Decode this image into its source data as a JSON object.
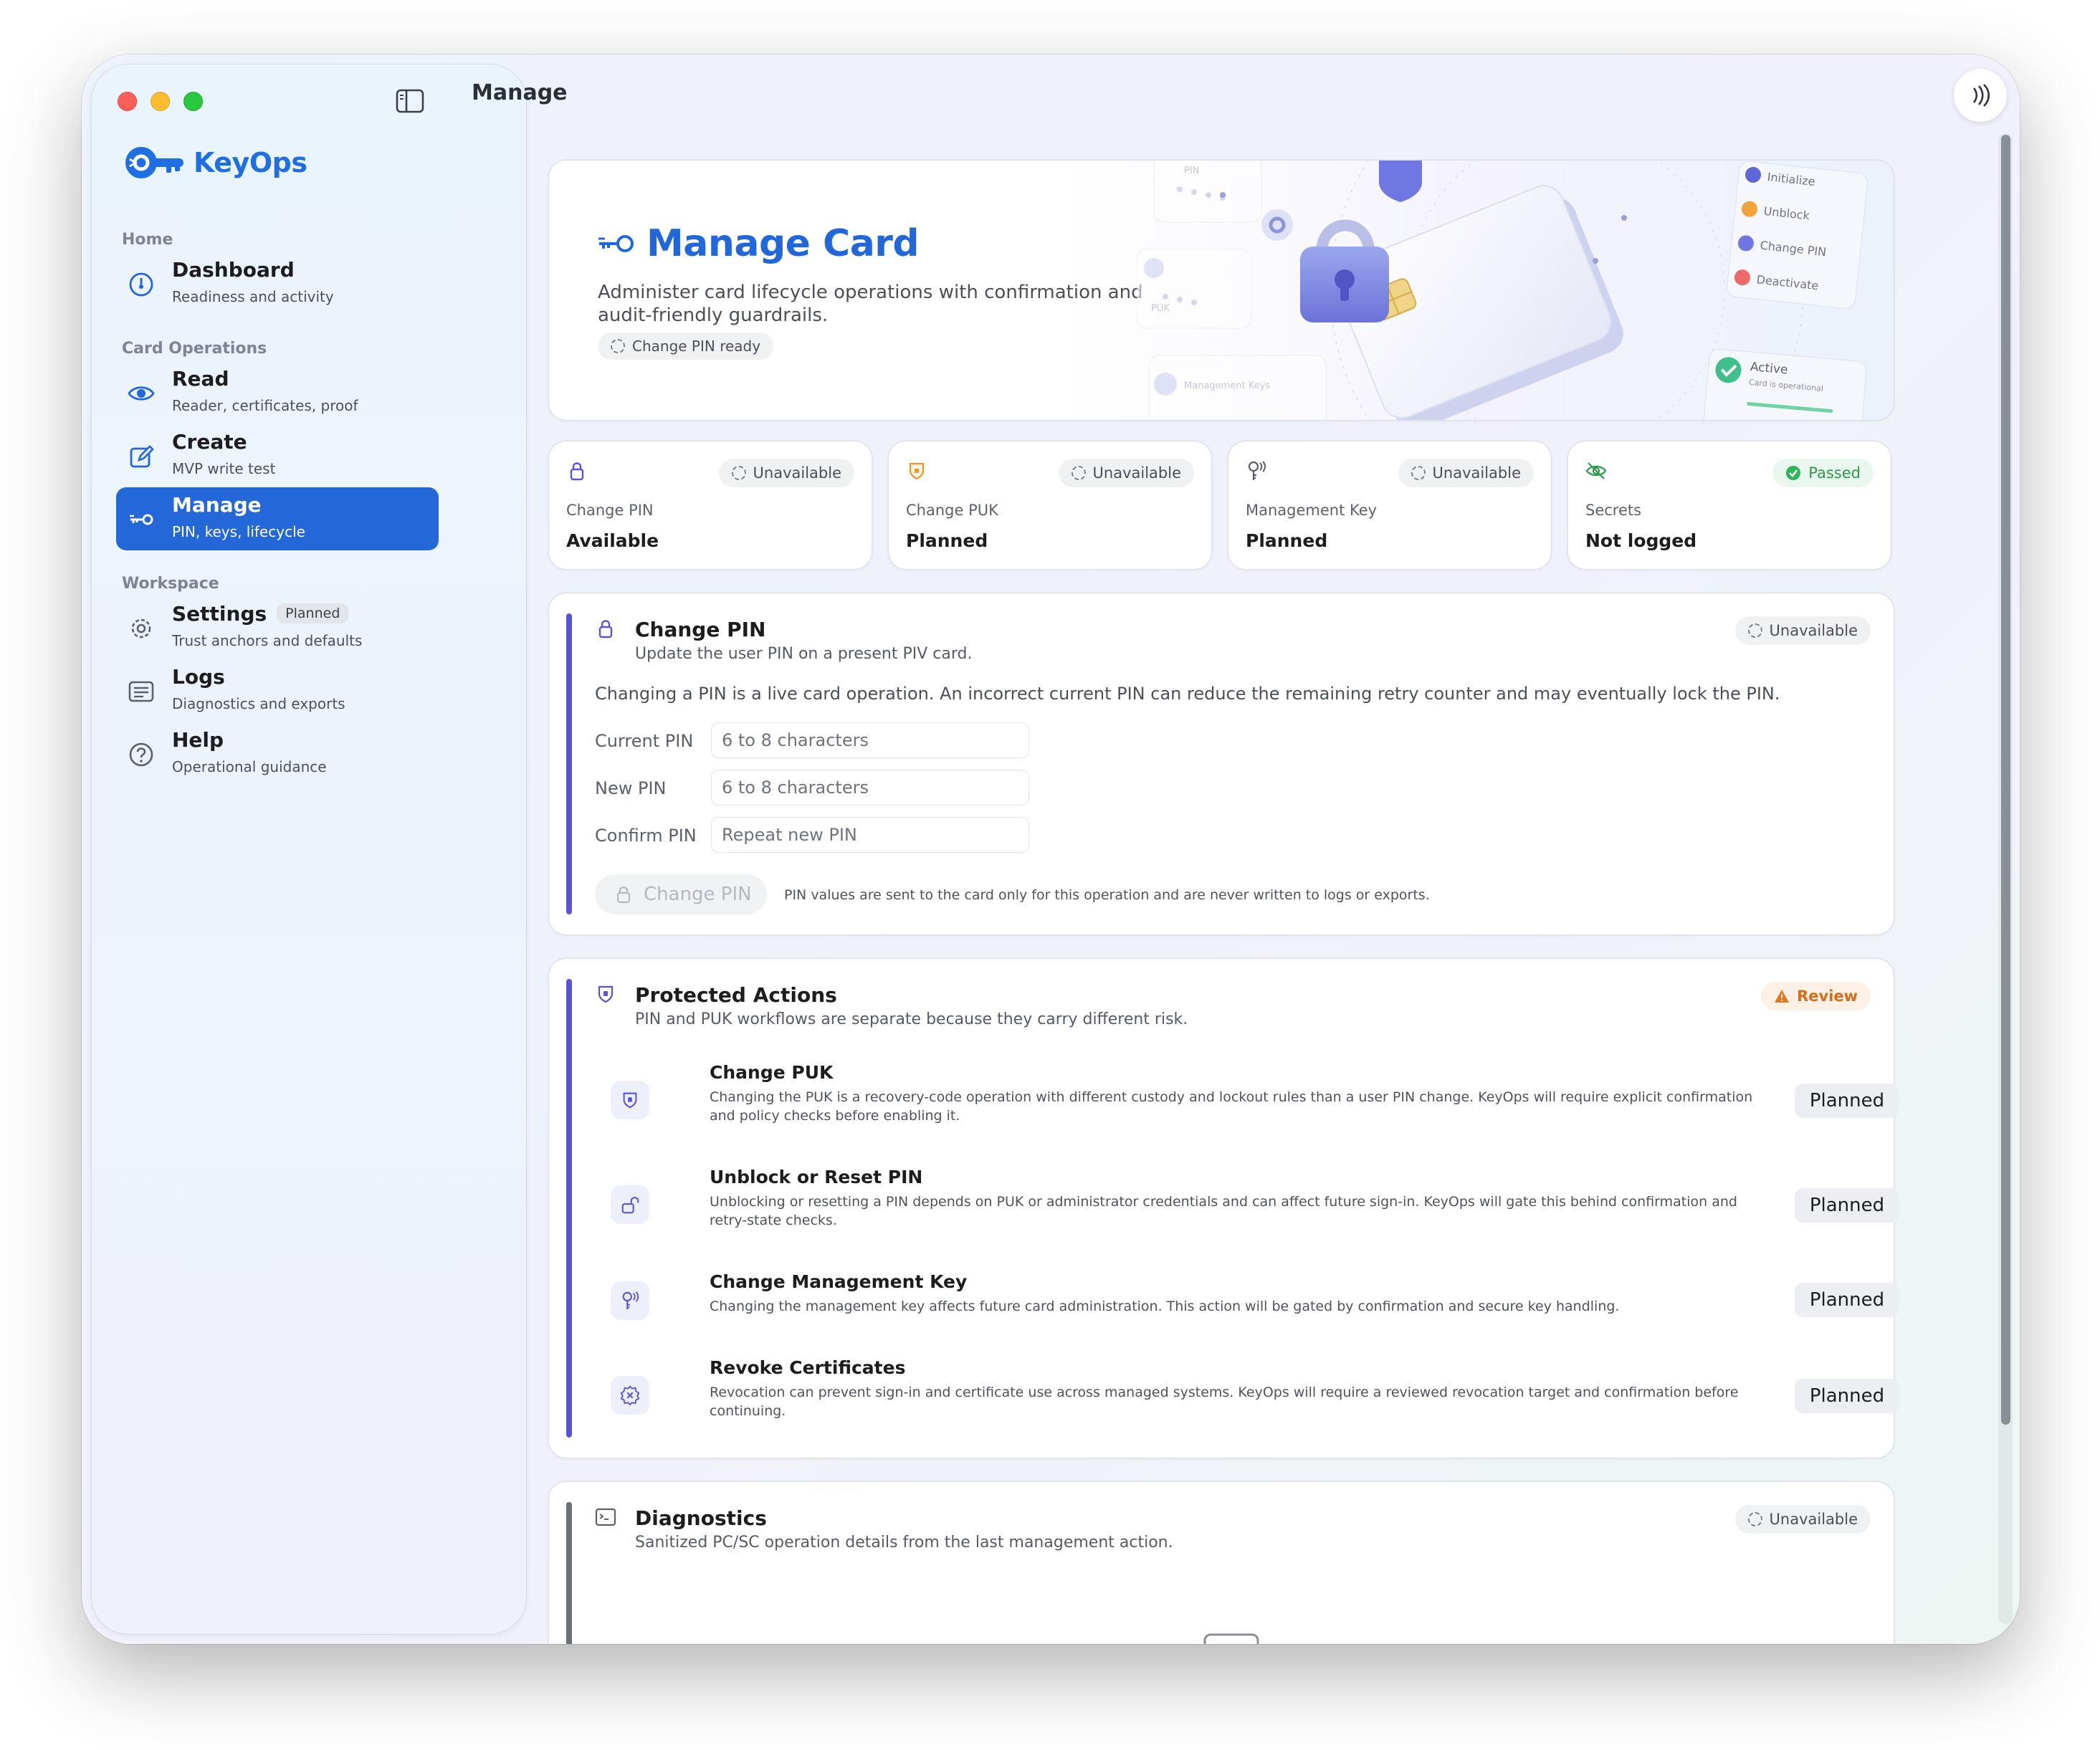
{
  "app": {
    "name": "KeyOps",
    "page_title": "Manage"
  },
  "sidebar": {
    "sections": [
      {
        "label": "Home"
      },
      {
        "label": "Card Operations"
      },
      {
        "label": "Workspace"
      }
    ],
    "items": [
      {
        "title": "Dashboard",
        "subtitle": "Readiness and activity"
      },
      {
        "title": "Read",
        "subtitle": "Reader, certificates, proof"
      },
      {
        "title": "Create",
        "subtitle": "MVP write test"
      },
      {
        "title": "Manage",
        "subtitle": "PIN, keys, lifecycle",
        "active": true
      },
      {
        "title": "Settings",
        "subtitle": "Trust anchors and defaults",
        "badge": "Planned"
      },
      {
        "title": "Logs",
        "subtitle": "Diagnostics and exports"
      },
      {
        "title": "Help",
        "subtitle": "Operational guidance"
      }
    ]
  },
  "hero": {
    "title": "Manage Card",
    "description": "Administer card lifecycle operations with confirmation and audit-friendly guardrails.",
    "status_pill": "Change PIN ready",
    "art": {
      "step_labels": [
        "Initialize",
        "Unblock",
        "Change PIN",
        "Deactivate"
      ],
      "active_label": "Active",
      "active_sub": "Card is operational",
      "side_labels": [
        "PIN",
        "PUK",
        "Management Keys"
      ]
    }
  },
  "status_cards": [
    {
      "label": "Change PIN",
      "value": "Available",
      "pill": "Unavailable",
      "icon": "lock-icon"
    },
    {
      "label": "Change PUK",
      "value": "Planned",
      "pill": "Unavailable",
      "icon": "shield-icon"
    },
    {
      "label": "Management Key",
      "value": "Planned",
      "pill": "Unavailable",
      "icon": "key-signal-icon"
    },
    {
      "label": "Secrets",
      "value": "Not logged",
      "pill": "Passed",
      "icon": "eye-slash-icon"
    }
  ],
  "change_pin": {
    "title": "Change PIN",
    "subtitle": "Update the user PIN on a present PIV card.",
    "pill": "Unavailable",
    "warning": "Changing a PIN is a live card operation. An incorrect current PIN can reduce the remaining retry counter and may eventually lock the PIN.",
    "fields": [
      {
        "label": "Current PIN",
        "placeholder": "6 to 8 characters"
      },
      {
        "label": "New PIN",
        "placeholder": "6 to 8 characters"
      },
      {
        "label": "Confirm PIN",
        "placeholder": "Repeat new PIN"
      }
    ],
    "button_label": "Change PIN",
    "note": "PIN values are sent to the card only for this operation and are never written to logs or exports."
  },
  "protected_actions": {
    "title": "Protected Actions",
    "subtitle": "PIN and PUK workflows are separate because they carry different risk.",
    "pill": "Review",
    "actions": [
      {
        "title": "Change PUK",
        "description": "Changing the PUK is a recovery-code operation with different custody and lockout rules than a user PIN change. KeyOps will require explicit confirmation and policy checks before enabling it.",
        "button": "Planned"
      },
      {
        "title": "Unblock or Reset PIN",
        "description": "Unblocking or resetting a PIN depends on PUK or administrator credentials and can affect future sign-in. KeyOps will gate this behind confirmation and retry-state checks.",
        "button": "Planned"
      },
      {
        "title": "Change Management Key",
        "description": "Changing the management key affects future card administration. This action will be gated by confirmation and secure key handling.",
        "button": "Planned"
      },
      {
        "title": "Revoke Certificates",
        "description": "Revocation can prevent sign-in and certificate use across managed systems. KeyOps will require a reviewed revocation target and confirmation before continuing.",
        "button": "Planned"
      }
    ]
  },
  "diagnostics": {
    "title": "Diagnostics",
    "subtitle": "Sanitized PC/SC operation details from the last management action.",
    "pill": "Unavailable"
  },
  "colors": {
    "accent": "#2467d9",
    "brand": "#1f6fe3",
    "section_accent": "#5a53d6",
    "passed": "#2b9a4a",
    "review": "#d86c1d"
  }
}
